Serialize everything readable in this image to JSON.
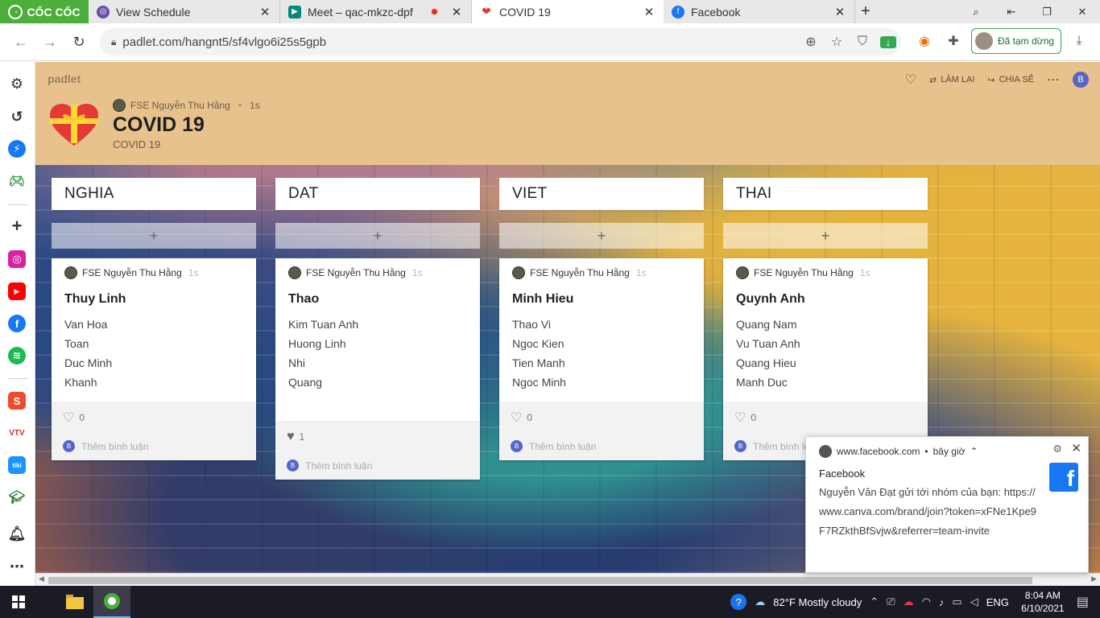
{
  "browser": {
    "brand": "CỐC CỐC",
    "tabs": [
      {
        "title": "View Schedule"
      },
      {
        "title": "Meet – qac-mkzc-dpf"
      },
      {
        "title": "COVID 19"
      },
      {
        "title": "Facebook"
      }
    ],
    "url": "padlet.com/hangnt5/sf4vlgo6i25s5gpb",
    "profile_status": "Đã tạm dừng"
  },
  "padlet": {
    "logo": "padlet",
    "author": "FSE Nguyễn Thu Hằng",
    "time": "1s",
    "title": "COVID 19",
    "subtitle": "COVID 19",
    "actions": {
      "remake": "LÀM LẠI",
      "share": "CHIA SẺ",
      "avatar": "B"
    },
    "add_symbol": "+",
    "columns": [
      {
        "name": "NGHIA",
        "card": {
          "author": "FSE Nguyễn Thu Hằng",
          "time": "1s",
          "title": "Thuy Linh",
          "lines": [
            "Van Hoa",
            "Toan",
            "Duc Minh",
            "Khanh"
          ],
          "likes": "0",
          "liked": false,
          "comment_placeholder": "Thêm bình luận"
        }
      },
      {
        "name": "DAT",
        "card": {
          "author": "FSE Nguyễn Thu Hằng",
          "time": "1s",
          "title": "Thao",
          "lines": [
            "Kim Tuan Anh",
            "Huong Linh",
            "Nhi",
            "Quang"
          ],
          "likes": "1",
          "liked": true,
          "comment_placeholder": "Thêm bình luận"
        }
      },
      {
        "name": "VIET",
        "card": {
          "author": "FSE Nguyễn Thu Hằng",
          "time": "1s",
          "title": "Minh Hieu",
          "lines": [
            "Thao Vi",
            "Ngoc Kien",
            "Tien Manh",
            "Ngoc Minh"
          ],
          "likes": "0",
          "liked": false,
          "comment_placeholder": "Thêm bình luận"
        }
      },
      {
        "name": "THAI",
        "card": {
          "author": "FSE Nguyễn Thu Hằng",
          "time": "1s",
          "title": "Quynh Anh",
          "lines": [
            "Quang Nam",
            "Vu Tuan Anh",
            "Quang Hieu",
            "Manh Duc"
          ],
          "likes": "0",
          "liked": false,
          "comment_placeholder": "Thêm bình luận"
        }
      }
    ]
  },
  "notification": {
    "site": "www.facebook.com",
    "when": "bây giờ",
    "app": "Facebook",
    "message": "Nguyễn Văn Đạt gửi tới nhóm của bạn: https://www.canva.com/brand/join?token=xFNe1Kpe9F7RZkthBfSvjw&referrer=team-invite"
  },
  "taskbar": {
    "weather": "82°F  Mostly cloudy",
    "lang": "ENG",
    "time": "8:04 AM",
    "date": "6/10/2021"
  },
  "colors": {
    "header_bg": "#e8c28c",
    "brand_green": "#4caf3b",
    "accent_blue": "#1877f2"
  }
}
